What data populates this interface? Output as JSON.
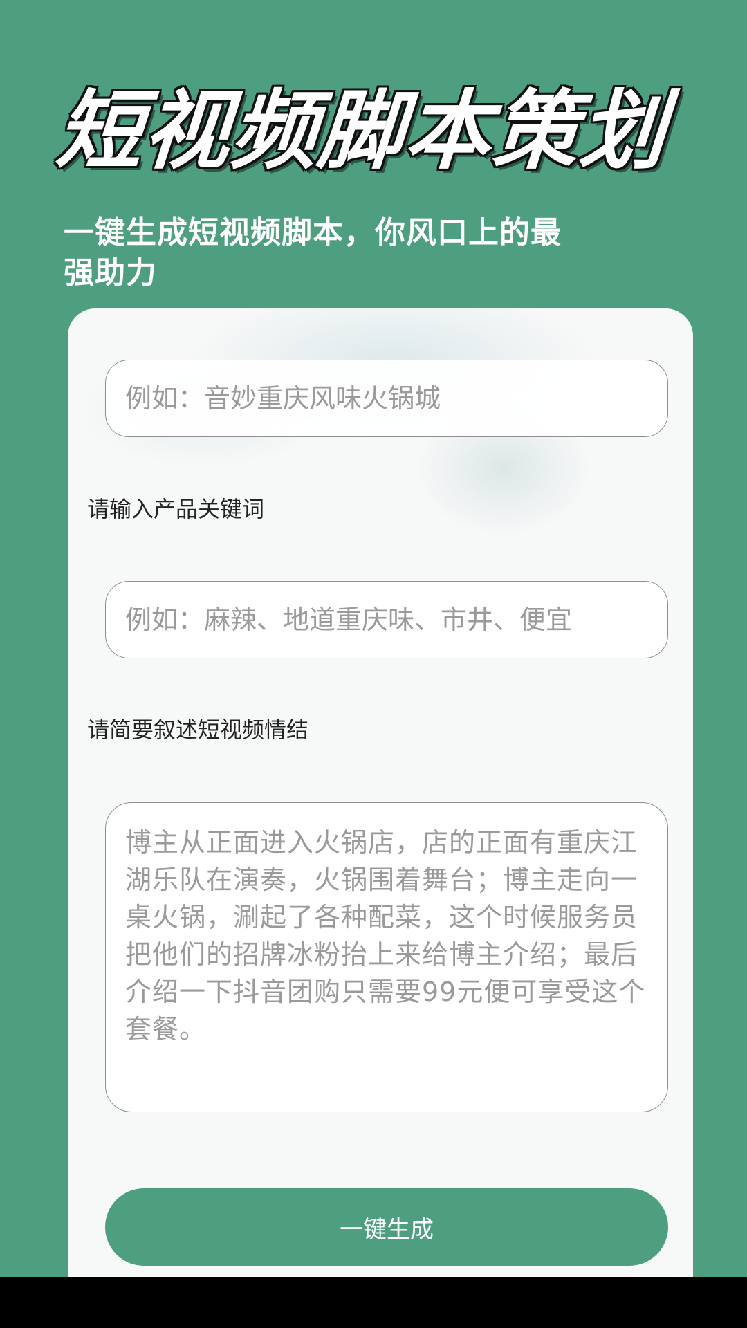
{
  "header": {
    "title": "短视频脚本策划",
    "subtitle": "一键生成短视频脚本，你风口上的最强助力"
  },
  "form": {
    "store_name_placeholder": "例如：音妙重庆风味火锅城",
    "keywords_label": "请输入产品关键词",
    "keywords_placeholder": "例如：麻辣、地道重庆味、市井、便宜",
    "plot_label": "请简要叙述短视频情结",
    "plot_placeholder": "博主从正面进入火锅店，店的正面有重庆江湖乐队在演奏，火锅围着舞台；博主走向一桌火锅，涮起了各种配菜，这个时候服务员把他们的招牌冰粉抬上来给博主介绍；最后介绍一下抖音团购只需要99元便可享受这个套餐。",
    "generate_label": "一键生成"
  },
  "colors": {
    "brand_green": "#4e9f80",
    "card_background": "#f7f8f8",
    "placeholder_gray": "#9a9a9a"
  }
}
